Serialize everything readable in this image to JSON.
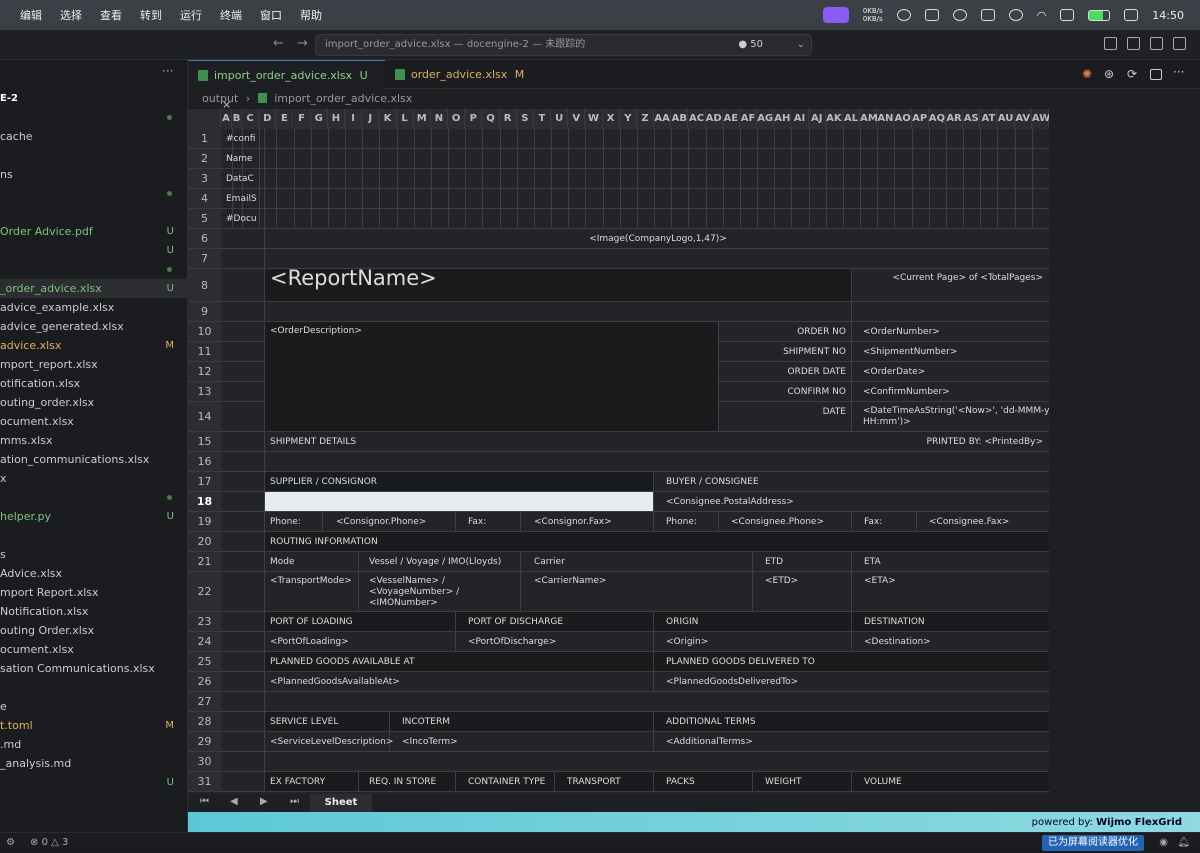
{
  "menu": {
    "items": [
      "编辑",
      "选择",
      "查看",
      "转到",
      "运行",
      "终端",
      "窗口",
      "帮助"
    ],
    "net_up": "0KB/s",
    "net_down": "0KB/s",
    "clock": "14:50"
  },
  "titlebar": {
    "search": "import_order_advice.xlsx — docengine-2 — 未跟踪的",
    "count": "50"
  },
  "sidebar": {
    "rows": [
      {
        "t": "E-2",
        "b": ""
      },
      {
        "t": "",
        "b": ""
      },
      {
        "t": "cache",
        "b": ""
      },
      {
        "t": "",
        "b": ""
      },
      {
        "t": "ns",
        "b": ""
      },
      {
        "t": "",
        "b": ""
      },
      {
        "t": "",
        "b": ""
      },
      {
        "t": "Order Advice.pdf",
        "b": "U"
      },
      {
        "t": "",
        "b": "U"
      },
      {
        "t": "",
        "b": ""
      },
      {
        "t": "_order_advice.xlsx",
        "b": "U"
      },
      {
        "t": "advice_example.xlsx",
        "b": ""
      },
      {
        "t": "advice_generated.xlsx",
        "b": ""
      },
      {
        "t": "advice.xlsx",
        "b": "M"
      },
      {
        "t": "mport_report.xlsx",
        "b": ""
      },
      {
        "t": "otification.xlsx",
        "b": ""
      },
      {
        "t": "outing_order.xlsx",
        "b": ""
      },
      {
        "t": "ocument.xlsx",
        "b": ""
      },
      {
        "t": "mms.xlsx",
        "b": ""
      },
      {
        "t": "ation_communications.xlsx",
        "b": ""
      },
      {
        "t": "x",
        "b": ""
      },
      {
        "t": "",
        "b": ""
      },
      {
        "t": "helper.py",
        "b": "U"
      },
      {
        "t": "",
        "b": ""
      },
      {
        "t": "s",
        "b": ""
      },
      {
        "t": "Advice.xlsx",
        "b": ""
      },
      {
        "t": "mport Report.xlsx",
        "b": ""
      },
      {
        "t": "Notification.xlsx",
        "b": ""
      },
      {
        "t": "outing Order.xlsx",
        "b": ""
      },
      {
        "t": "ocument.xlsx",
        "b": ""
      },
      {
        "t": "sation Communications.xlsx",
        "b": ""
      },
      {
        "t": "",
        "b": ""
      },
      {
        "t": "e",
        "b": ""
      },
      {
        "t": "t.toml",
        "b": "M"
      },
      {
        "t": ".md",
        "b": ""
      },
      {
        "t": "_analysis.md",
        "b": ""
      },
      {
        "t": "",
        "b": "U"
      }
    ]
  },
  "tabs": [
    {
      "label": "import_order_advice.xlsx",
      "badge": "U"
    },
    {
      "label": "order_advice.xlsx",
      "badge": "M"
    }
  ],
  "breadcrumb": {
    "folder": "output",
    "file": "import_order_advice.xlsx"
  },
  "grid": {
    "columns": [
      "A",
      "B",
      "C",
      "D",
      "E",
      "F",
      "G",
      "H",
      "I",
      "J",
      "K",
      "L",
      "M",
      "N",
      "O",
      "P",
      "Q",
      "R",
      "S",
      "T",
      "U",
      "V",
      "W",
      "X",
      "Y",
      "Z",
      "AA",
      "AB",
      "AC",
      "AD",
      "AE",
      "AF",
      "AG",
      "AH",
      "AI",
      "AJ",
      "AK",
      "AL",
      "AM",
      "AN",
      "AO",
      "AP",
      "AQ",
      "AR",
      "AS",
      "AT",
      "AU",
      "AV",
      "AW"
    ],
    "rows": [
      "1",
      "2",
      "3",
      "4",
      "5",
      "6",
      "7",
      "8",
      "9",
      "10",
      "11",
      "12",
      "13",
      "14",
      "15",
      "16",
      "17",
      "18",
      "19",
      "20",
      "21",
      "22",
      "23",
      "24",
      "25",
      "26",
      "27",
      "28",
      "29",
      "30",
      "31"
    ],
    "col_a_texts": [
      "#confi",
      "Name",
      "DataC",
      "EmailS",
      "#Docu"
    ],
    "logo": "<Image(CompanyLogo,1,47)>",
    "report_name": "<ReportName>",
    "page_info": "<Current Page> of <TotalPages>",
    "order_desc": "<OrderDescription>",
    "labels": {
      "order_no": "ORDER NO",
      "shipment_no": "SHIPMENT NO",
      "order_date": "ORDER DATE",
      "confirm_no": "CONFIRM NO",
      "date": "DATE"
    },
    "values": {
      "order_no": "<OrderNumber>",
      "shipment_no": "<ShipmentNumber>",
      "order_date": "<OrderDate>",
      "confirm_no": "<ConfirmNumber>",
      "date1": "<DateTimeAsString('<Now>', 'dd-MMM-yy",
      "date2": "HH:mm')>"
    },
    "shipment_details": "SHIPMENT DETAILS",
    "printed_by": "PRINTED BY: <PrintedBy>",
    "supplier": "SUPPLIER / CONSIGNOR",
    "buyer": "BUYER / CONSIGNEE",
    "consignee_addr": "<Consignee.PostalAddress>",
    "phone": "Phone:",
    "fax": "Fax:",
    "consignor_phone": "<Consignor.Phone>",
    "consignor_fax": "<Consignor.Fax>",
    "consignee_phone": "<Consignee.Phone>",
    "consignee_fax": "<Consignee.Fax>",
    "routing": "ROUTING INFORMATION",
    "r21": {
      "mode": "Mode",
      "vessel": "Vessel / Voyage / IMO(Lloyds)",
      "carrier": "Carrier",
      "etd": "ETD",
      "eta": "ETA"
    },
    "r22": {
      "mode": "<TransportMode>",
      "vessel1": "<VesselName> /",
      "vessel2": "<VoyageNumber> /",
      "vessel3": "<IMONumber>",
      "carrier": "<CarrierName>",
      "etd": "<ETD>",
      "eta": "<ETA>"
    },
    "r23": {
      "pol": "PORT OF LOADING",
      "pod": "PORT OF DISCHARGE",
      "origin": "ORIGIN",
      "dest": "DESTINATION"
    },
    "r24": {
      "pol": "<PortOfLoading>",
      "pod": "<PortOfDischarge>",
      "origin": "<Origin>",
      "dest": "<Destination>"
    },
    "r25": {
      "avail": "PLANNED GOODS AVAILABLE AT",
      "deliv": "PLANNED GOODS DELIVERED TO"
    },
    "r26": {
      "avail": "<PlannedGoodsAvailableAt>",
      "deliv": "<PlannedGoodsDeliveredTo>"
    },
    "r28": {
      "service": "SERVICE LEVEL",
      "incoterm": "INCOTERM",
      "terms": "ADDITIONAL TERMS"
    },
    "r29": {
      "service": "<ServiceLevelDescription>",
      "incoterm": "<IncoTerm>",
      "terms": "<AdditionalTerms>"
    },
    "r31": {
      "exf": "EX FACTORY",
      "req": "REQ. IN STORE",
      "cont": "CONTAINER TYPE",
      "trans": "TRANSPORT",
      "packs": "PACKS",
      "weight": "WEIGHT",
      "volume": "VOLUME"
    }
  },
  "sheet_tab": "Sheet",
  "powered_prefix": "powered by:",
  "powered_brand": "Wijmo FlexGrid",
  "status": {
    "errors": "0",
    "warnings": "3",
    "reader": "已为屏幕阅读器优化"
  }
}
